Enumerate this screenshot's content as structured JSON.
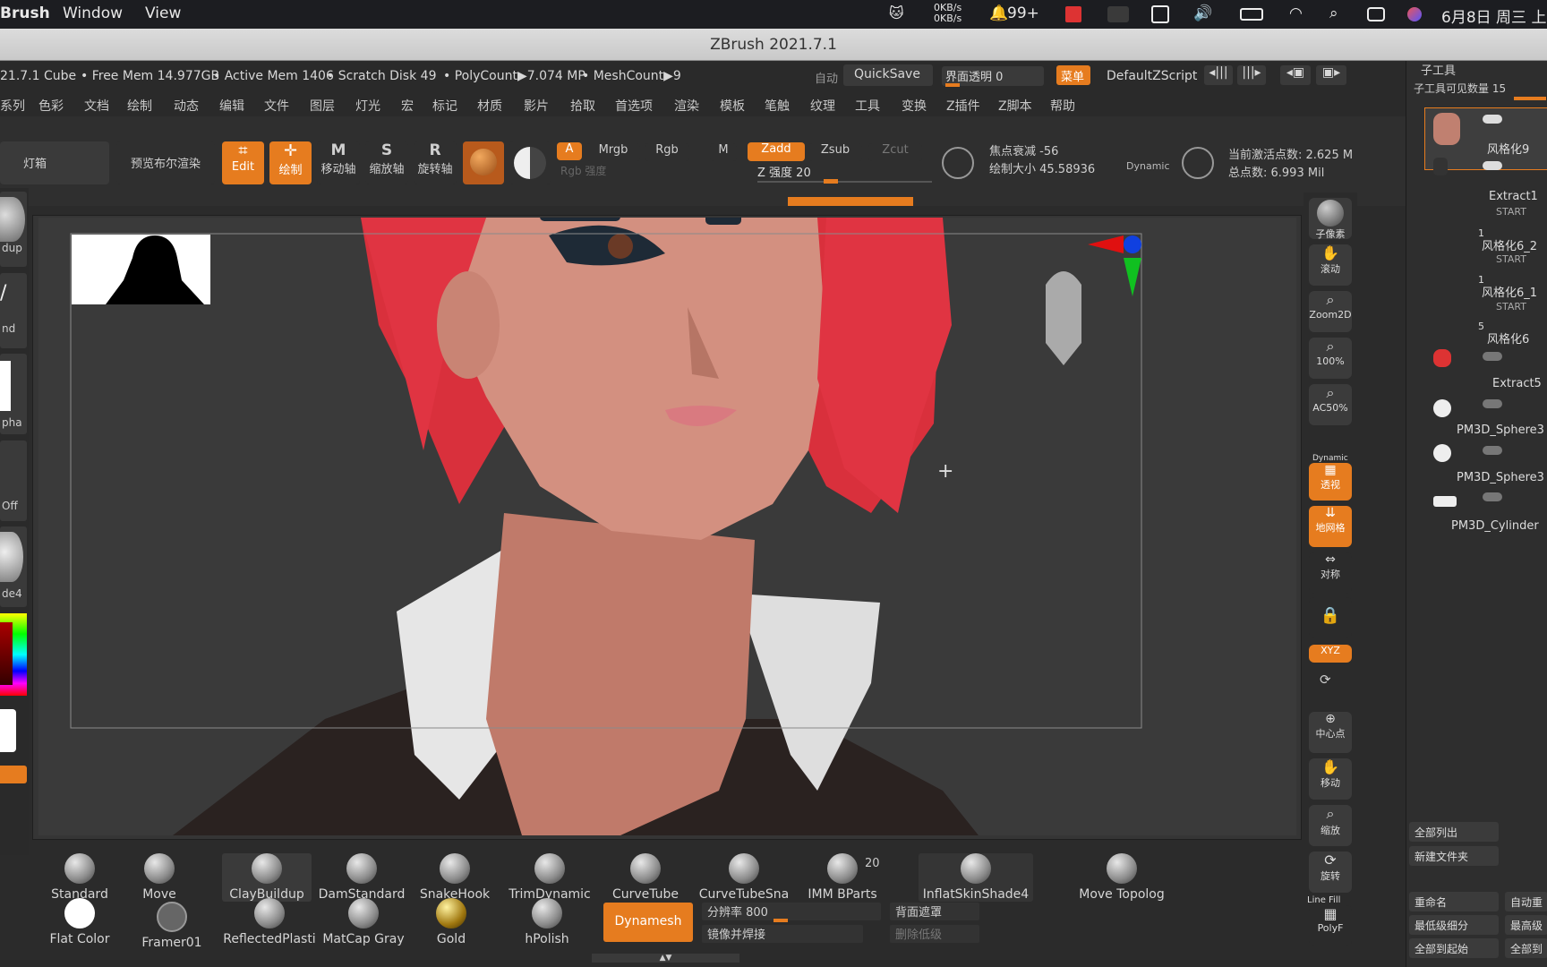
{
  "menubar": {
    "app": "Brush",
    "items": [
      "Window",
      "View"
    ],
    "net_up": "0KB/s",
    "net_down": "0KB/s",
    "notify": "99+",
    "datetime": "6月8日 周三 上"
  },
  "window_title": "ZBrush 2021.7.1",
  "info": {
    "doc": "21.7.1 Cube",
    "free_mem": "• Free Mem 14.977GB",
    "active_mem": "• Active Mem 1406",
    "scratch": "• Scratch Disk 49",
    "polycount": "• PolyCount▶7.074 MP",
    "meshcount": "• MeshCount▶9",
    "auto": "自动",
    "quicksave": "QuickSave",
    "transparency": "界面透明 0",
    "menus_btn": "菜单",
    "script": "DefaultZScript"
  },
  "menu_items": [
    "系列",
    "色彩",
    "文档",
    "绘制",
    "动态",
    "编辑",
    "文件",
    "图层",
    "灯光",
    "宏",
    "标记",
    "材质",
    "影片",
    "拾取",
    "首选项",
    "渲染",
    "模板",
    "笔触",
    "纹理",
    "工具",
    "变换",
    "Z插件",
    "Z脚本",
    "帮助"
  ],
  "toolbar": {
    "lightbox": "灯箱",
    "preview": "预览布尔渲染",
    "edit": "Edit",
    "draw": "绘制",
    "move": "移动轴",
    "scale": "缩放轴",
    "rotate": "旋转轴",
    "a": "A",
    "mrgb": "Mrgb",
    "rgb": "Rgb",
    "m": "M",
    "zadd": "Zadd",
    "zsub": "Zsub",
    "zcut": "Zcut",
    "rgb_intensity": "Rgb 强度",
    "z_intensity": "Z 强度 20",
    "focal": "焦点衰减 -56",
    "draw_size": "绘制大小 45.58936",
    "dynamic": "Dynamic",
    "active_points": "当前激活点数: 2.625 M",
    "total_points": "总点数: 6.993 Mil"
  },
  "left_panel": [
    "dup",
    "nd",
    "pha",
    "Off",
    "de4"
  ],
  "right_strip": [
    "子像素",
    "滚动",
    "Zoom2D",
    "100%",
    "AC50%",
    "透视",
    "地网格",
    "对称",
    "XYZ",
    "中心点",
    "移动",
    "缩放",
    "旋转",
    "PolyF"
  ],
  "right_strip_extra": {
    "dynamic": "Dynamic",
    "linefill": "Line Fill"
  },
  "subtool": {
    "title": "子工具",
    "visible_count": "子工具可见数量 15",
    "items": [
      {
        "name": "风格化9",
        "sub": ""
      },
      {
        "name": "Extract1",
        "sub": "START"
      },
      {
        "name": "风格化6_2",
        "sub": "START"
      },
      {
        "name": "风格化6_1",
        "sub": "START"
      },
      {
        "name": "风格化6",
        "sub": ""
      },
      {
        "name": "Extract5",
        "sub": ""
      },
      {
        "name": "PM3D_Sphere3",
        "sub": ""
      },
      {
        "name": "PM3D_Sphere3",
        "sub": ""
      },
      {
        "name": "PM3D_Cylinder",
        "sub": ""
      }
    ],
    "nums": [
      "1",
      "1",
      "5"
    ],
    "buttons": [
      "全部列出",
      "新建文件夹",
      "重命名",
      "自动重",
      "最低级细分",
      "最高级",
      "全部到起始",
      "全部到"
    ]
  },
  "brushes_row1": [
    "Standard",
    "Move",
    "ClayBuildup",
    "DamStandard",
    "SnakeHook",
    "TrimDynamic",
    "CurveTube",
    "CurveTubeSna",
    "IMM BParts",
    "InflatSkinShade4",
    "Move Topolog"
  ],
  "brush_count": "20",
  "brushes_row2": [
    "Flat Color",
    "Framer01",
    "ReflectedPlasti",
    "MatCap Gray",
    "Gold",
    "hPolish"
  ],
  "dynamesh": {
    "label": "Dynamesh",
    "resolution": "分辨率 800",
    "mirror": "镜像并焊接",
    "backface": "背面遮罩",
    "delete_lower": "删除低级"
  }
}
